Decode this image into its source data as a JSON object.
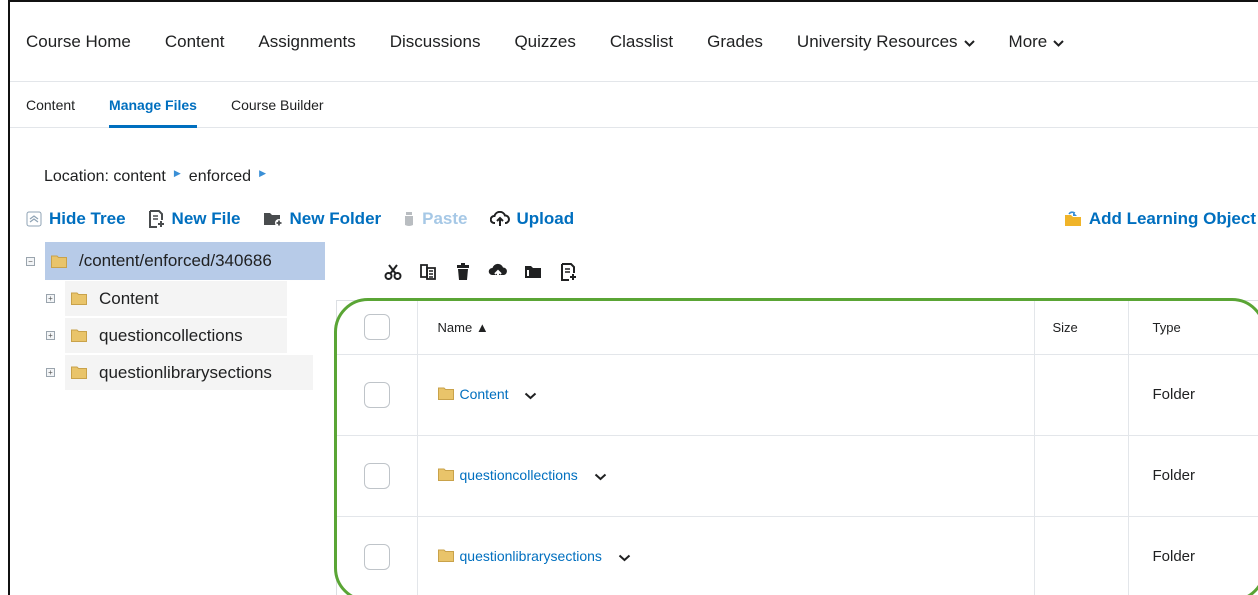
{
  "nav": {
    "items": [
      {
        "label": "Course Home",
        "dropdown": false
      },
      {
        "label": "Content",
        "dropdown": false
      },
      {
        "label": "Assignments",
        "dropdown": false
      },
      {
        "label": "Discussions",
        "dropdown": false
      },
      {
        "label": "Quizzes",
        "dropdown": false
      },
      {
        "label": "Classlist",
        "dropdown": false
      },
      {
        "label": "Grades",
        "dropdown": false
      },
      {
        "label": "University Resources",
        "dropdown": true
      },
      {
        "label": "More",
        "dropdown": true
      }
    ]
  },
  "subtabs": [
    {
      "label": "Content",
      "active": false
    },
    {
      "label": "Manage Files",
      "active": true
    },
    {
      "label": "Course Builder",
      "active": false
    }
  ],
  "location": {
    "label": "Location:",
    "path": [
      "content",
      "enforced"
    ]
  },
  "toolbar": {
    "hide_tree": "Hide Tree",
    "new_file": "New File",
    "new_folder": "New Folder",
    "paste": "Paste",
    "upload": "Upload",
    "add_learning_object": "Add Learning Object"
  },
  "tree": {
    "root": "/content/enforced/340686",
    "children": [
      "Content",
      "questioncollections",
      "questionlibrarysections"
    ]
  },
  "icon_toolbar": [
    "cut-icon",
    "copy-icon",
    "delete-icon",
    "upload-icon",
    "move-icon",
    "new-file-icon"
  ],
  "table": {
    "headers": {
      "name": "Name",
      "size": "Size",
      "type": "Type"
    },
    "sort_indicator": "▲",
    "rows": [
      {
        "name": "Content",
        "size": "",
        "type": "Folder"
      },
      {
        "name": "questioncollections",
        "size": "",
        "type": "Folder"
      },
      {
        "name": "questionlibrarysections",
        "size": "",
        "type": "Folder"
      }
    ]
  },
  "colors": {
    "link": "#006fbf",
    "highlight": "#5aa535",
    "folder": "#e9c46a",
    "tree_selected": "#b7cbe8"
  }
}
